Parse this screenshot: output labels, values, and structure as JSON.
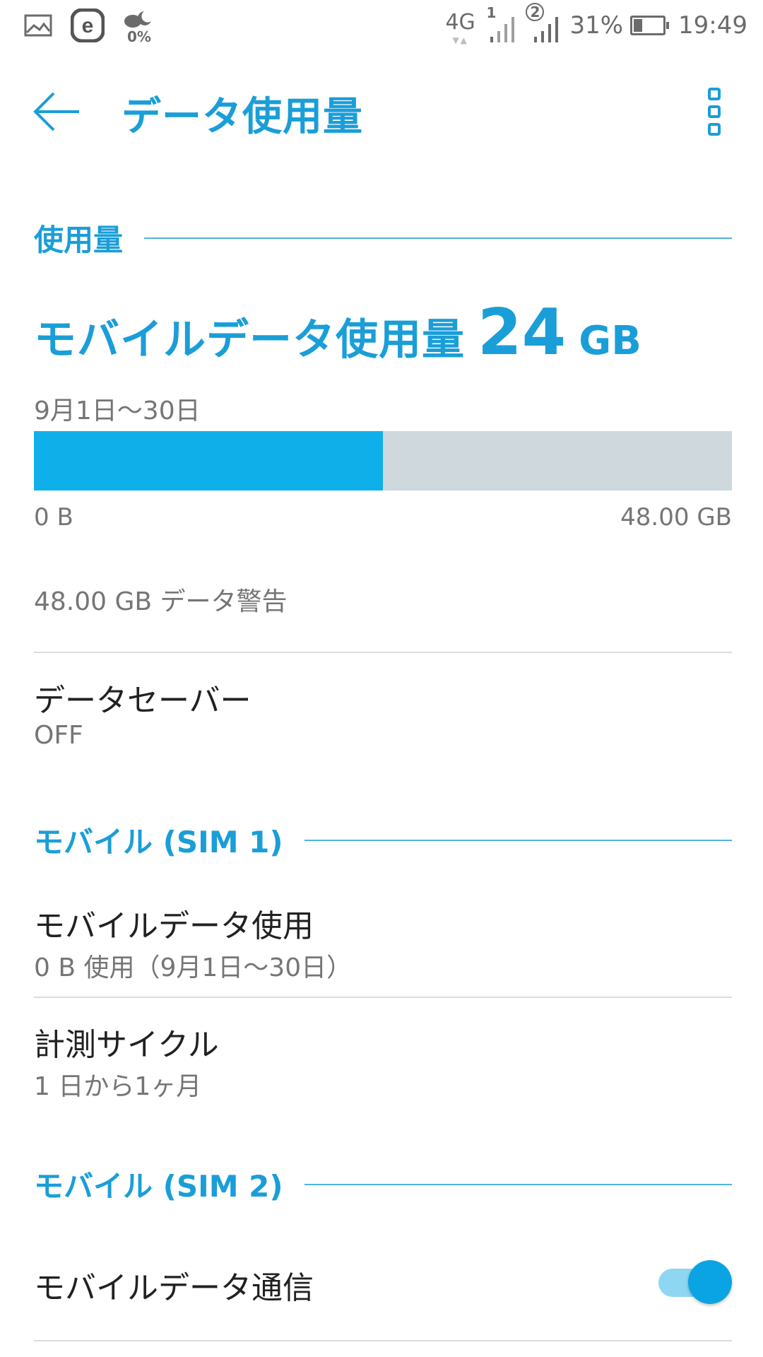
{
  "status_bar": {
    "icons_left": [
      "gallery-icon",
      "e-app-icon",
      "weather-icon"
    ],
    "weather_label": "0%",
    "network": "4G",
    "sim1_label": "1",
    "sim2_label": "2",
    "battery": "31%",
    "battery_level": 0.31,
    "time": "19:49"
  },
  "app_bar": {
    "title": "データ使用量"
  },
  "usage": {
    "section": "使用量",
    "title": "モバイルデータ使用量",
    "amount": "24",
    "unit": "GB",
    "period": "9月1日〜30日",
    "fraction": 0.5,
    "bar_min": "0 B",
    "bar_max": "48.00 GB",
    "warning": "48.00 GB データ警告"
  },
  "data_saver": {
    "title": "データセーバー",
    "value": "OFF"
  },
  "sim1": {
    "section": "モバイル (SIM 1)",
    "items": [
      {
        "title": "モバイルデータ使用",
        "subtitle": "0 B 使用（9月1日〜30日）"
      },
      {
        "title": "計測サイクル",
        "subtitle": "1 日から1ヶ月"
      }
    ]
  },
  "sim2": {
    "section": "モバイル (SIM 2)",
    "items": [
      {
        "title": "モバイルデータ通信",
        "toggle_on": true
      }
    ]
  },
  "colors": {
    "accent": "#1a9ed8",
    "bar_fill": "#0fb0ea",
    "bar_track": "#cfd8dc"
  }
}
